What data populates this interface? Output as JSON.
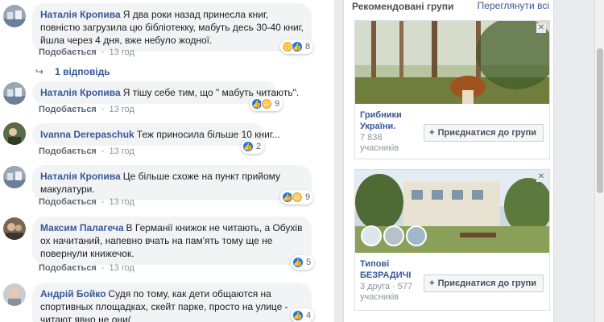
{
  "comments": [
    {
      "author": "Наталія Кропива",
      "text": "Я два роки назад принесла книг, повністю загрузила цю бібліотекку, мабуть десь 30-40 книг, йшла через 4 дня, вже небуло жодної.",
      "like_label": "Подобається",
      "time": "13 год",
      "reaction_count": "8"
    },
    {
      "author": "Наталія Кропива",
      "text": "Я тішу себе тим, що \" мабуть читають\".",
      "like_label": "Подобається",
      "time": "13 год",
      "reaction_count": "9"
    },
    {
      "author": "Ivanna Derepaschuk",
      "text": "Теж приносила більше 10 книг...",
      "like_label": "Подобається",
      "time": "13 год",
      "reaction_count": "2"
    },
    {
      "author": "Наталія Кропива",
      "text": "Це більше схоже на пункт прийому макулатури.",
      "like_label": "Подобається",
      "time": "13 год",
      "reaction_count": "9"
    },
    {
      "author": "Максим Палагеча",
      "text": "В Германії книжок не читають, а Обухів ох начитаний, напевно вчать на пам'ять тому ще не повернули книжечок.",
      "like_label": "Подобається",
      "time": "13 год",
      "reaction_count": "5"
    },
    {
      "author": "Андрій Бойко",
      "text": "Судя по тому, как дети общаются на спортивных площадках, скейт парке, просто на улице - читают явно не они(",
      "reaction_count": "4"
    }
  ],
  "replies_label": "1 відповідь",
  "sidebar": {
    "title": "Рекомендовані групи",
    "see_all": "Переглянути всі",
    "groups": [
      {
        "name": "Грибники України.",
        "members_count": "7 838",
        "members_label": "учасників",
        "join_label": "Приєднатися до групи"
      },
      {
        "name": "Типові БЕЗРАДИЧІ",
        "friends": "3 друга",
        "members_count": "577",
        "members_label": "учасників",
        "join_label": "Приєднатися до групи"
      }
    ]
  },
  "colors": {
    "link": "#385898",
    "like_blue": "#1877f2",
    "bubble": "#f2f3f5"
  }
}
